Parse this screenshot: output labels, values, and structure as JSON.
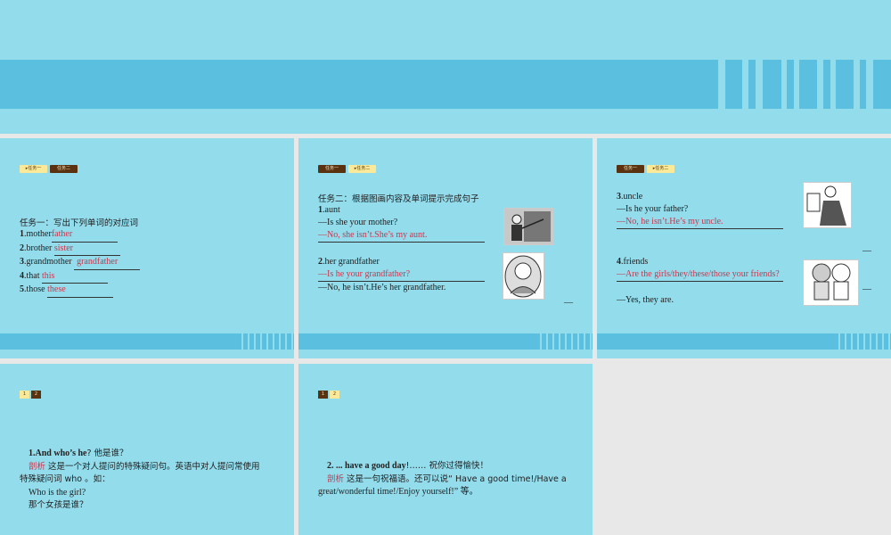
{
  "slide_top": {},
  "tabs": {
    "task1": "任务一",
    "task2": "任务二",
    "n1": "1",
    "n2": "2"
  },
  "slide1": {
    "heading": "任务一：写出下列单词的对应词",
    "items": [
      {
        "num": "1",
        "word": ".mother",
        "answer": "father"
      },
      {
        "num": "2",
        "word": ".brother ",
        "answer": "sister"
      },
      {
        "num": "3",
        "word": ".grandmother ",
        "answer": "grandfather"
      },
      {
        "num": "4",
        "word": ".that ",
        "answer": "this"
      },
      {
        "num": "5",
        "word": ".those ",
        "answer": "these"
      }
    ]
  },
  "slide2": {
    "heading": "任务二：根据图画内容及单词提示完成句子",
    "q1_num": "1",
    "q1_word": ".aunt",
    "q1_line1": "—Is she your mother?",
    "q1_answer": "—No, she isn’t.She’s my aunt.",
    "q2_num": "2",
    "q2_word": ".her grandfather",
    "q2_answer": "—Is he your grandfather?",
    "q2_line2": "—No, he isn’t.He’s her grandfather.",
    "dash": "—"
  },
  "slide3": {
    "q3_num": "3",
    "q3_word": ".uncle",
    "q3_line1": "—Is he your father?",
    "q3_answer": "—No, he isn’t.He’s my uncle.",
    "q4_num": "4",
    "q4_word": ".friends",
    "q4_answer": "—Are the girls/they/these/those your friends?",
    "q4_line2": "—Yes, they are.",
    "dash": "—"
  },
  "slide4": {
    "title_bold": "1.And who’s he",
    "title_rest": "? 他是谁？",
    "label": "剖析",
    "analysis": " 这是一个对人提问的特殊疑问句。英语中对人提问常使用",
    "analysis2": "特殊疑问词 who 。如：",
    "example_en": "Who is the girl?",
    "example_cn": "那个女孩是谁？"
  },
  "slide5": {
    "title_bold": "2. ... have a good day",
    "title_rest": "!…… 祝你过得愉快！",
    "label": "剖析",
    "analysis": " 这是一句祝福语。还可以说“ Have a good time!/Have a",
    "analysis2": "great/wonderful time!/Enjoy yourself!” 等。"
  }
}
